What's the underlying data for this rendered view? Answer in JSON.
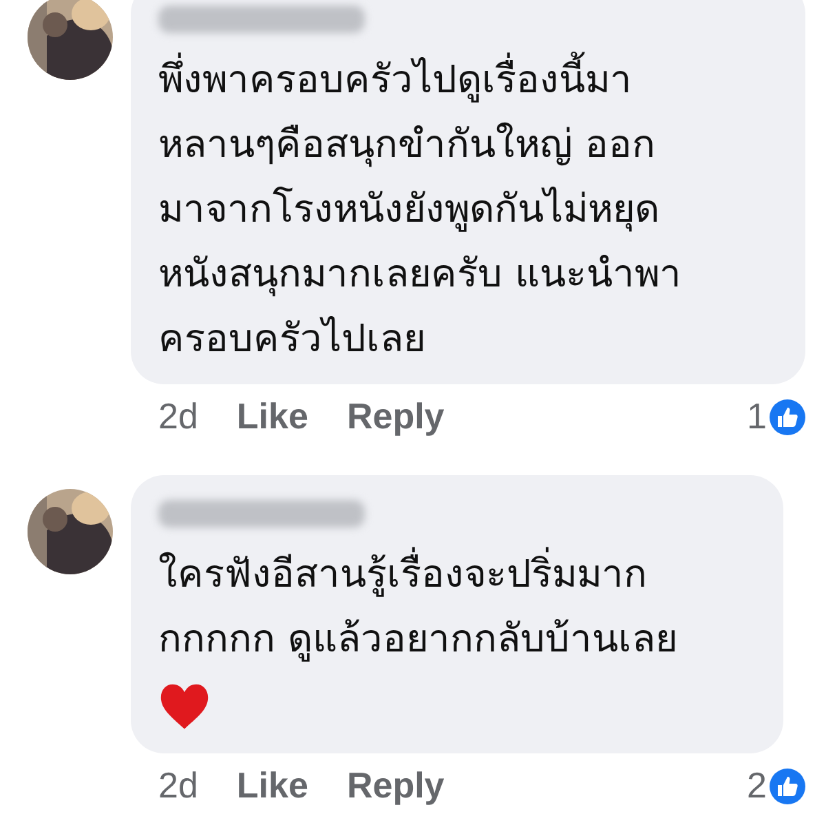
{
  "comments": [
    {
      "text": "พึ่งพาครอบครัวไปดูเรื่องนี้มา\nหลานๆคือสนุกขำกันใหญ่ ออก\nมาจากโรงหนังยังพูดกันไม่หยุด\nหนังสนุกมากเลยครับ แนะนำพา\nครอบครัวไปเลย",
      "time": "2d",
      "like": "Like",
      "reply": "Reply",
      "reactions": "1"
    },
    {
      "text": "ใครฟังอีสานรู้เรื่องจะปริ่มมาก\nกกกกก ดูแล้วอยากกลับบ้านเลย",
      "heart": true,
      "time": "2d",
      "like": "Like",
      "reply": "Reply",
      "reactions": "2"
    }
  ]
}
